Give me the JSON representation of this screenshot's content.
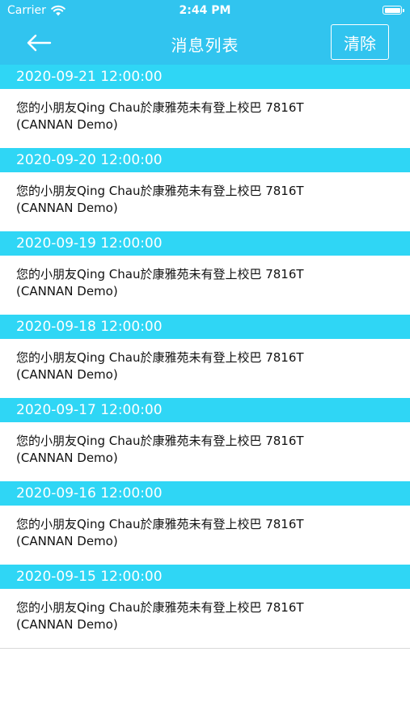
{
  "status_bar": {
    "carrier": "Carrier",
    "time": "2:44 PM"
  },
  "nav": {
    "title": "消息列表",
    "clear_label": "清除"
  },
  "colors": {
    "header_bg": "#31c4ef",
    "date_bar_bg": "#2fd6f5"
  },
  "messages": [
    {
      "date": "2020-09-21 12:00:00",
      "line1": "您的小朋友Qing Chau於康雅苑未有登上校巴 7816T",
      "line2": "(CANNAN Demo)"
    },
    {
      "date": "2020-09-20 12:00:00",
      "line1": "您的小朋友Qing Chau於康雅苑未有登上校巴 7816T",
      "line2": "(CANNAN Demo)"
    },
    {
      "date": "2020-09-19 12:00:00",
      "line1": "您的小朋友Qing Chau於康雅苑未有登上校巴 7816T",
      "line2": "(CANNAN Demo)"
    },
    {
      "date": "2020-09-18 12:00:00",
      "line1": "您的小朋友Qing Chau於康雅苑未有登上校巴 7816T",
      "line2": "(CANNAN Demo)"
    },
    {
      "date": "2020-09-17 12:00:00",
      "line1": "您的小朋友Qing Chau於康雅苑未有登上校巴 7816T",
      "line2": "(CANNAN Demo)"
    },
    {
      "date": "2020-09-16 12:00:00",
      "line1": "您的小朋友Qing Chau於康雅苑未有登上校巴 7816T",
      "line2": "(CANNAN Demo)"
    },
    {
      "date": "2020-09-15 12:00:00",
      "line1": "您的小朋友Qing Chau於康雅苑未有登上校巴 7816T",
      "line2": "(CANNAN Demo)"
    }
  ]
}
